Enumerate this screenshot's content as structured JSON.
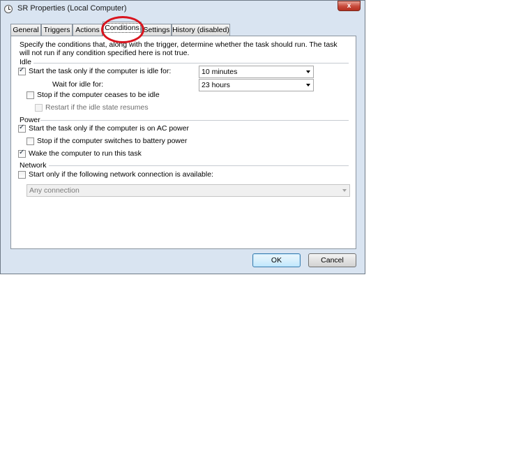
{
  "window": {
    "title": "SR Properties (Local Computer)",
    "close_label": "x"
  },
  "tabs": [
    {
      "label": "General"
    },
    {
      "label": "Triggers"
    },
    {
      "label": "Actions"
    },
    {
      "label": "Conditions",
      "selected": true
    },
    {
      "label": "Settings"
    },
    {
      "label": "History (disabled)"
    }
  ],
  "description": "Specify the conditions that, along with the trigger, determine whether the task should run.  The task will not run  if any condition specified here is not true.",
  "idle": {
    "group_label": "Idle",
    "start_if_idle": {
      "label": "Start the task only if the computer is idle for:",
      "checked": true
    },
    "idle_duration": "10 minutes",
    "wait_label": "Wait for idle for:",
    "wait_duration": "23 hours",
    "stop_if_not_idle": {
      "label": "Stop if the computer ceases to be idle",
      "checked": false
    },
    "restart_if_idle": {
      "label": "Restart if the idle state resumes",
      "checked": false,
      "disabled": true
    }
  },
  "power": {
    "group_label": "Power",
    "ac_power": {
      "label": "Start the task only if the computer is on AC power",
      "checked": true
    },
    "stop_on_battery": {
      "label": "Stop if the computer switches to battery power",
      "checked": false
    },
    "wake": {
      "label": "Wake the computer to run this task",
      "checked": true
    }
  },
  "network": {
    "group_label": "Network",
    "start_if_network": {
      "label": "Start only if the following network connection is available:",
      "checked": false
    },
    "connection": "Any connection"
  },
  "buttons": {
    "ok": "OK",
    "cancel": "Cancel"
  },
  "colors": {
    "highlight_circle": "#d9141e",
    "window_frame": "#d9e4f1"
  }
}
